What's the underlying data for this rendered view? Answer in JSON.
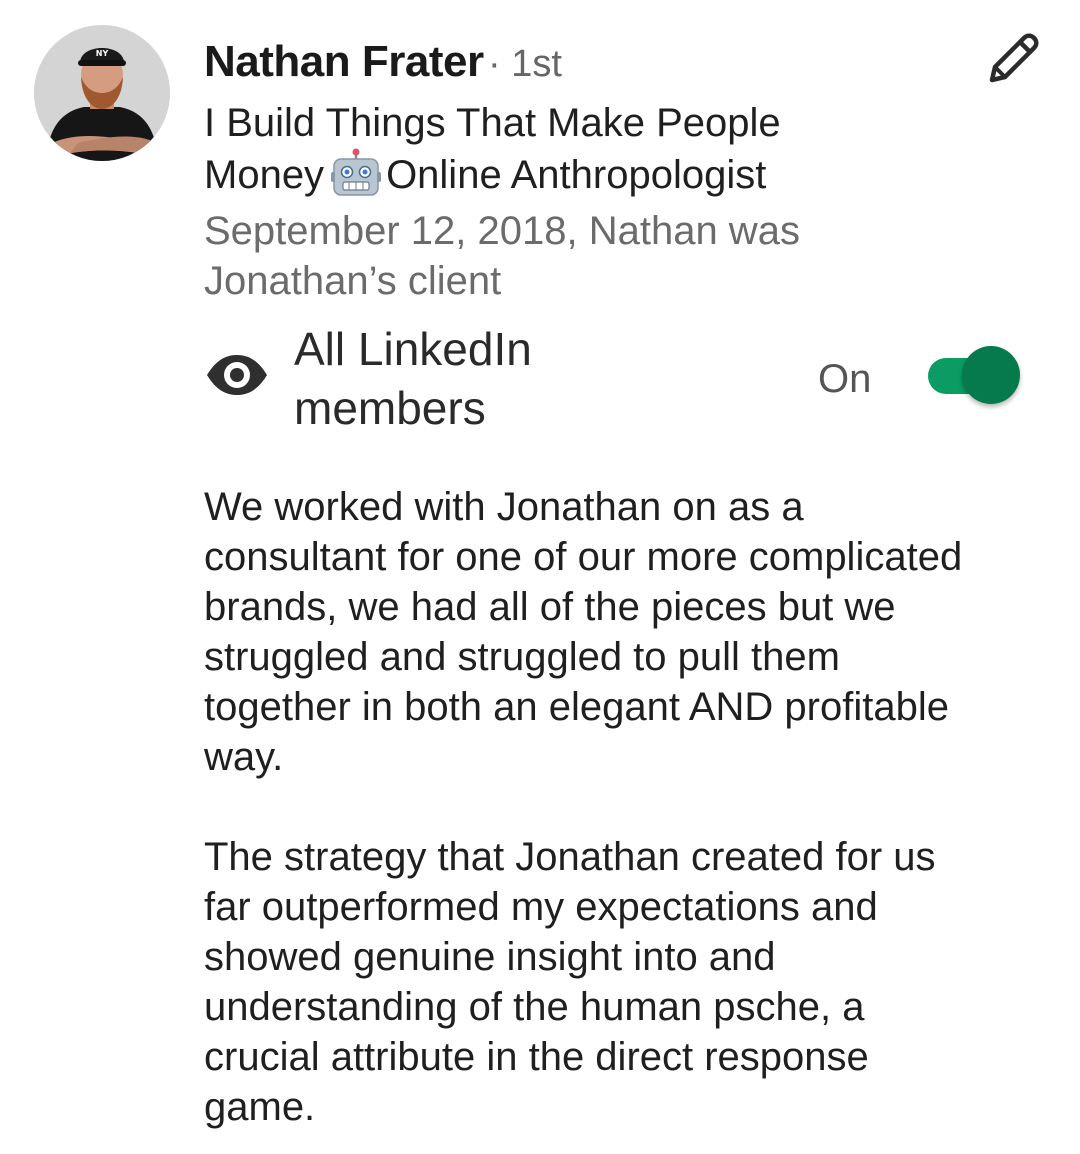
{
  "profile": {
    "name": "Nathan Frater",
    "degree": "· 1st",
    "headline_lines": [
      "I Build Things That Make People",
      "Money",
      "Online Anthropologist"
    ],
    "headline_emoji": "robot-face-icon",
    "relation_lines": [
      "September 12, 2018, Nathan was",
      "Jonathan’s client"
    ]
  },
  "visibility": {
    "icon": "eye-icon",
    "label_lines": [
      "All LinkedIn",
      "members"
    ],
    "toggle_state_label": "On",
    "toggle_on": true,
    "toggle_color": "#0a9c63"
  },
  "actions": {
    "edit_icon": "pencil-icon"
  },
  "recommendation": {
    "paragraph1": [
      "We worked with Jonathan on as a",
      "consultant for one of our more complicated",
      "brands, we had all of the pieces but we",
      "struggled and struggled to pull them",
      "together in both an elegant AND profitable",
      "way."
    ],
    "paragraph2": [
      "The strategy that Jonathan created for us",
      "far outperformed my expectations and",
      "showed genuine insight into and",
      "understanding of the human psche, a",
      "crucial attribute in the direct response",
      "game."
    ]
  }
}
